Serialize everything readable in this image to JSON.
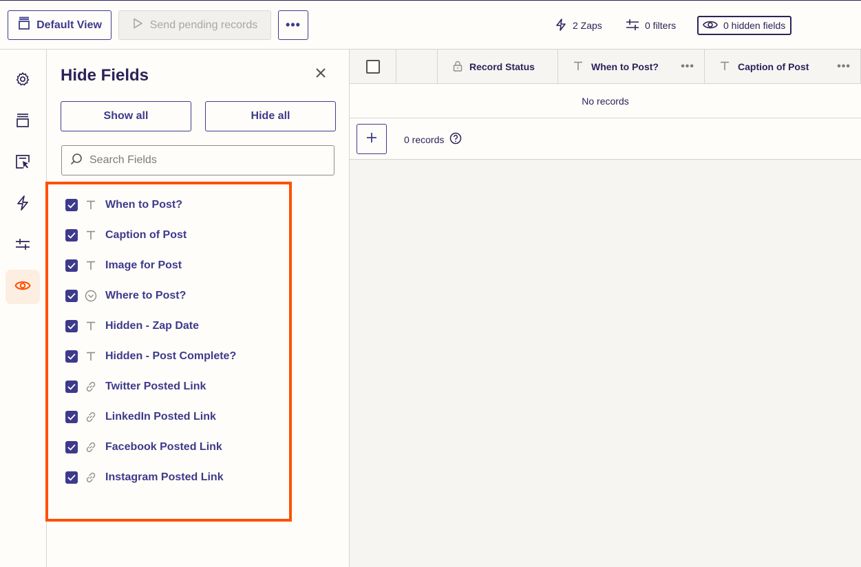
{
  "toolbar": {
    "default_view_label": "Default View",
    "send_pending_label": "Send pending records",
    "more_label": "•••",
    "zaps_label": "2 Zaps",
    "filters_label": "0 filters",
    "hidden_fields_label": "0 hidden fields"
  },
  "nav": {
    "items": [
      "gear-icon",
      "views-icon",
      "interface-icon",
      "zap-icon",
      "filters-icon",
      "eye-icon"
    ],
    "active": "eye-icon"
  },
  "panel": {
    "title": "Hide Fields",
    "show_all_label": "Show all",
    "hide_all_label": "Hide all",
    "search_placeholder": "Search Fields",
    "fields": [
      {
        "name": "When to Post?",
        "type": "text",
        "checked": true
      },
      {
        "name": "Caption of Post",
        "type": "text",
        "checked": true
      },
      {
        "name": "Image for Post",
        "type": "text",
        "checked": true
      },
      {
        "name": "Where to Post?",
        "type": "dropdown",
        "checked": true
      },
      {
        "name": "Hidden - Zap Date",
        "type": "text",
        "checked": true
      },
      {
        "name": "Hidden - Post Complete?",
        "type": "text",
        "checked": true
      },
      {
        "name": "Twitter Posted Link",
        "type": "link",
        "checked": true
      },
      {
        "name": "LinkedIn Posted Link",
        "type": "link",
        "checked": true
      },
      {
        "name": "Facebook Posted Link",
        "type": "link",
        "checked": true
      },
      {
        "name": "Instagram Posted Link",
        "type": "link",
        "checked": true
      }
    ]
  },
  "grid": {
    "columns": [
      "Record Status",
      "When to Post?",
      "Caption of Post"
    ],
    "column_more_label": "•••",
    "empty_text": "No records",
    "record_count": "0 records"
  },
  "colors": {
    "accent": "#3d3a8c",
    "highlight": "#ff4f00",
    "active_nav": "#ff4f00"
  }
}
